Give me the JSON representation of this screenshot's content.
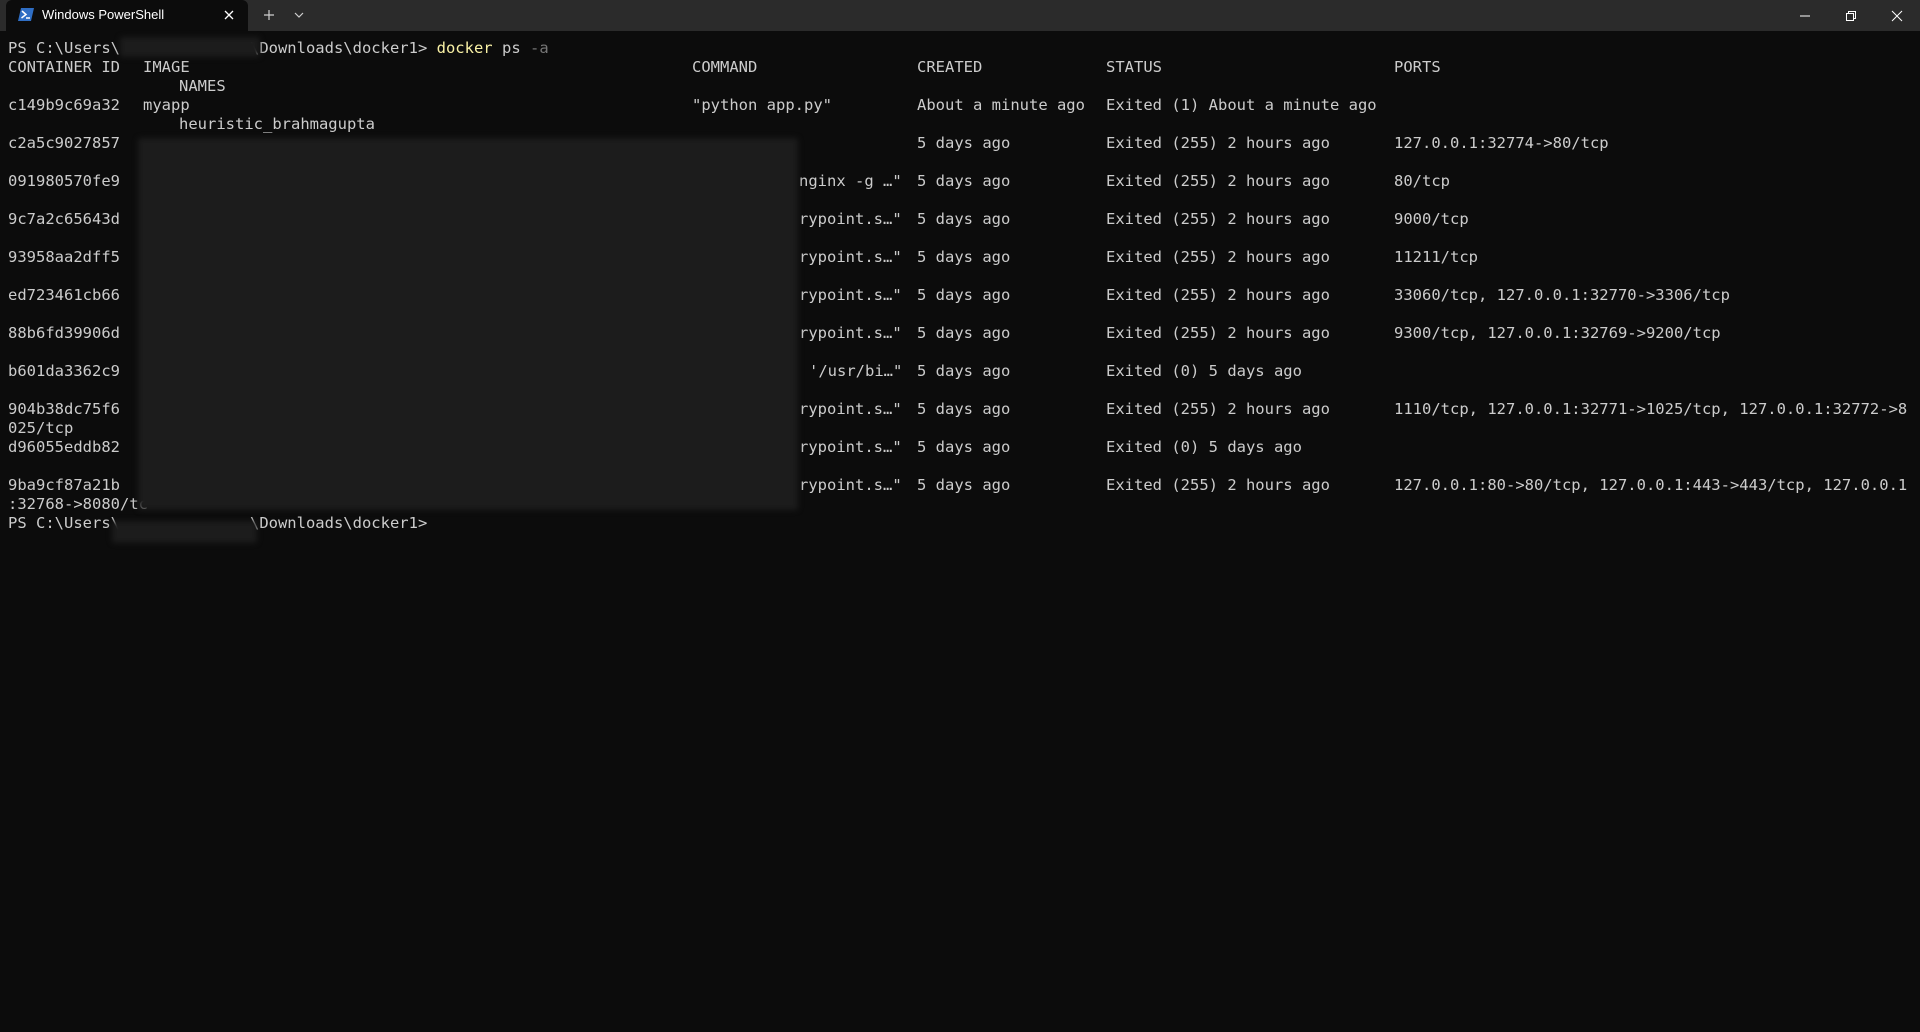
{
  "window": {
    "tab_title": "Windows PowerShell",
    "icons": {
      "tab": "powershell-icon",
      "close_tab": "close-icon",
      "new_tab": "plus-icon",
      "dropdown": "chevron-down-icon",
      "minimize": "minimize-icon",
      "restore": "restore-icon",
      "close": "close-icon"
    },
    "colors": {
      "titlebar": "#2b2b2b",
      "background": "#0c0c0c",
      "text": "#cccccc",
      "command": "#f9f1a5",
      "flag": "#767676"
    }
  },
  "terminal": {
    "prompt1": {
      "prefix": "PS C:\\Users\\",
      "path": "\\Downloads\\docker1>",
      "command": "docker",
      "arg": "ps",
      "flag": "-a"
    },
    "headers": {
      "id": "CONTAINER ID",
      "image": "IMAGE",
      "command": "COMMAND",
      "created": "CREATED",
      "status": "STATUS",
      "ports": "PORTS",
      "names": "NAMES"
    },
    "rows": [
      {
        "id": "c149b9c69a32",
        "image": "myapp",
        "command": "\"python app.py\"",
        "created": "About a minute ago",
        "status": "Exited (1) About a minute ago",
        "ports": "",
        "wrap": "",
        "names": "heuristic_brahmagupta"
      },
      {
        "id": "c2a5c9027857",
        "image": "",
        "command": "",
        "created": "5 days ago",
        "status": "Exited (255) 2 hours ago",
        "ports": "127.0.0.1:32774->80/tcp",
        "wrap": "",
        "names": ""
      },
      {
        "id": "091980570fe9",
        "image": "",
        "command": "nginx -g …\"",
        "created": "5 days ago",
        "status": "Exited (255) 2 hours ago",
        "ports": "80/tcp",
        "wrap": "",
        "names": ""
      },
      {
        "id": "9c7a2c65643d",
        "image": "",
        "command": "rypoint.s…\"",
        "created": "5 days ago",
        "status": "Exited (255) 2 hours ago",
        "ports": "9000/tcp",
        "wrap": "",
        "names": ""
      },
      {
        "id": "93958aa2dff5",
        "image": "",
        "command": "rypoint.s…\"",
        "created": "5 days ago",
        "status": "Exited (255) 2 hours ago",
        "ports": "11211/tcp",
        "wrap": "",
        "names": ""
      },
      {
        "id": "ed723461cb66",
        "image": "",
        "command": "rypoint.s…\"",
        "created": "5 days ago",
        "status": "Exited (255) 2 hours ago",
        "ports": "33060/tcp, 127.0.0.1:32770->3306/tcp",
        "wrap": "",
        "names": ""
      },
      {
        "id": "88b6fd39906d",
        "image": "",
        "command": "rypoint.s…\"",
        "created": "5 days ago",
        "status": "Exited (255) 2 hours ago",
        "ports": "9300/tcp, 127.0.0.1:32769->9200/tcp",
        "wrap": "",
        "names": ""
      },
      {
        "id": "b601da3362c9",
        "image": "",
        "command": "'/usr/bi…\"",
        "created": "5 days ago",
        "status": "Exited (0) 5 days ago",
        "ports": "",
        "wrap": "",
        "names": ""
      },
      {
        "id": "904b38dc75f6",
        "image": "",
        "command": "rypoint.s…\"",
        "created": "5 days ago",
        "status": "Exited (255) 2 hours ago",
        "ports": "1110/tcp, 127.0.0.1:32771->1025/tcp, 127.0.0.1:32772->8",
        "wrap": "025/tcp",
        "names": ""
      },
      {
        "id": "d96055eddb82",
        "image": "",
        "command": "rypoint.s…\"",
        "created": "5 days ago",
        "status": "Exited (0) 5 days ago",
        "ports": "",
        "wrap": "",
        "names": ""
      },
      {
        "id": "9ba9cf87a21b",
        "image": "",
        "command": "rypoint.s…\"",
        "created": "5 days ago",
        "status": "Exited (255) 2 hours ago",
        "ports": "127.0.0.1:80->80/tcp, 127.0.0.1:443->443/tcp, 127.0.0.1",
        "wrap": ":32768->8080/tc",
        "names": ""
      }
    ],
    "prompt2": {
      "prefix": "PS C:\\Users\\",
      "path": "\\Downloads\\docker1>"
    }
  }
}
